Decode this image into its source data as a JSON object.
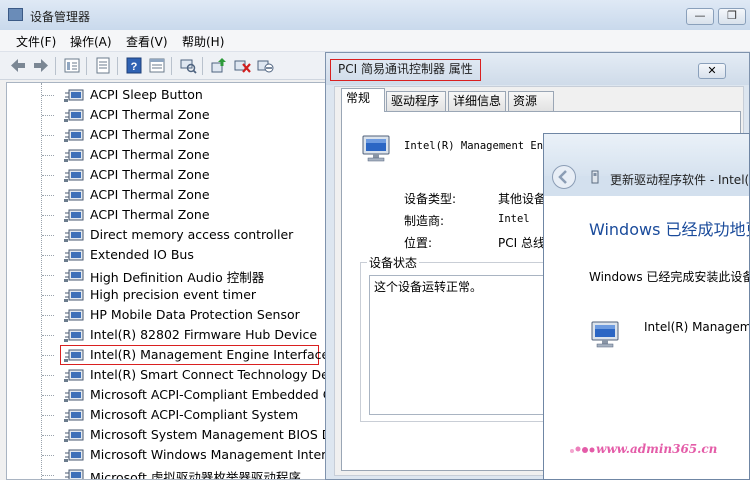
{
  "device_manager": {
    "title": "设备管理器",
    "caption_minimize": "—",
    "caption_restore": "❐",
    "menu": [
      "文件(F)",
      "操作(A)",
      "查看(V)",
      "帮助(H)"
    ],
    "toolbar_icons": [
      "back-arrow-icon",
      "forward-arrow-icon",
      "tree-view-icon",
      "properties-icon",
      "help-icon",
      "list-view-icon",
      "scan-hardware-icon",
      "update-driver-icon",
      "uninstall-icon",
      "disable-icon"
    ],
    "devices": [
      "ACPI Sleep Button",
      "ACPI Thermal Zone",
      "ACPI Thermal Zone",
      "ACPI Thermal Zone",
      "ACPI Thermal Zone",
      "ACPI Thermal Zone",
      "ACPI Thermal Zone",
      "Direct memory access controller",
      "Extended IO Bus",
      "High Definition Audio 控制器",
      "High precision event timer",
      "HP Mobile Data Protection Sensor",
      "Intel(R) 82802 Firmware Hub Device",
      "Intel(R) Management Engine Interface",
      "Intel(R) Smart Connect Technology Device",
      "Microsoft ACPI-Compliant Embedded Co",
      "Microsoft ACPI-Compliant System",
      "Microsoft System Management BIOS Dri",
      "Microsoft Windows Management Interfa",
      "Microsoft 虚拟驱动器枚举器驱动程序"
    ],
    "highlighted_device": "Intel(R) Management Engine Interface"
  },
  "properties_dialog": {
    "title": "PCI 简易通讯控制器 属性",
    "close": "✕",
    "tabs": [
      "常规",
      "驱动程序",
      "详细信息",
      "资源"
    ],
    "active_tab": "常规",
    "device_name": "Intel(R) Management Engine Interface",
    "device_type_label": "设备类型:",
    "device_type_value": "其他设备",
    "manufacturer_label": "制造商:",
    "manufacturer_value": "Intel",
    "location_label": "位置:",
    "location_value": "PCI 总线",
    "status_group_label": "设备状态",
    "status_text": "这个设备运转正常。"
  },
  "update_dialog": {
    "title": "更新驱动程序软件 - Intel(R",
    "heading": "Windows 已经成功地更",
    "description": "Windows 已经完成安装此设备",
    "device_name": "Intel(R) Manageme"
  },
  "watermark": "www.admin365.cn",
  "colors": {
    "highlight_red": "#d92020",
    "heading_blue": "#1a4b9b",
    "watermark_pink": "#e45ca8"
  }
}
